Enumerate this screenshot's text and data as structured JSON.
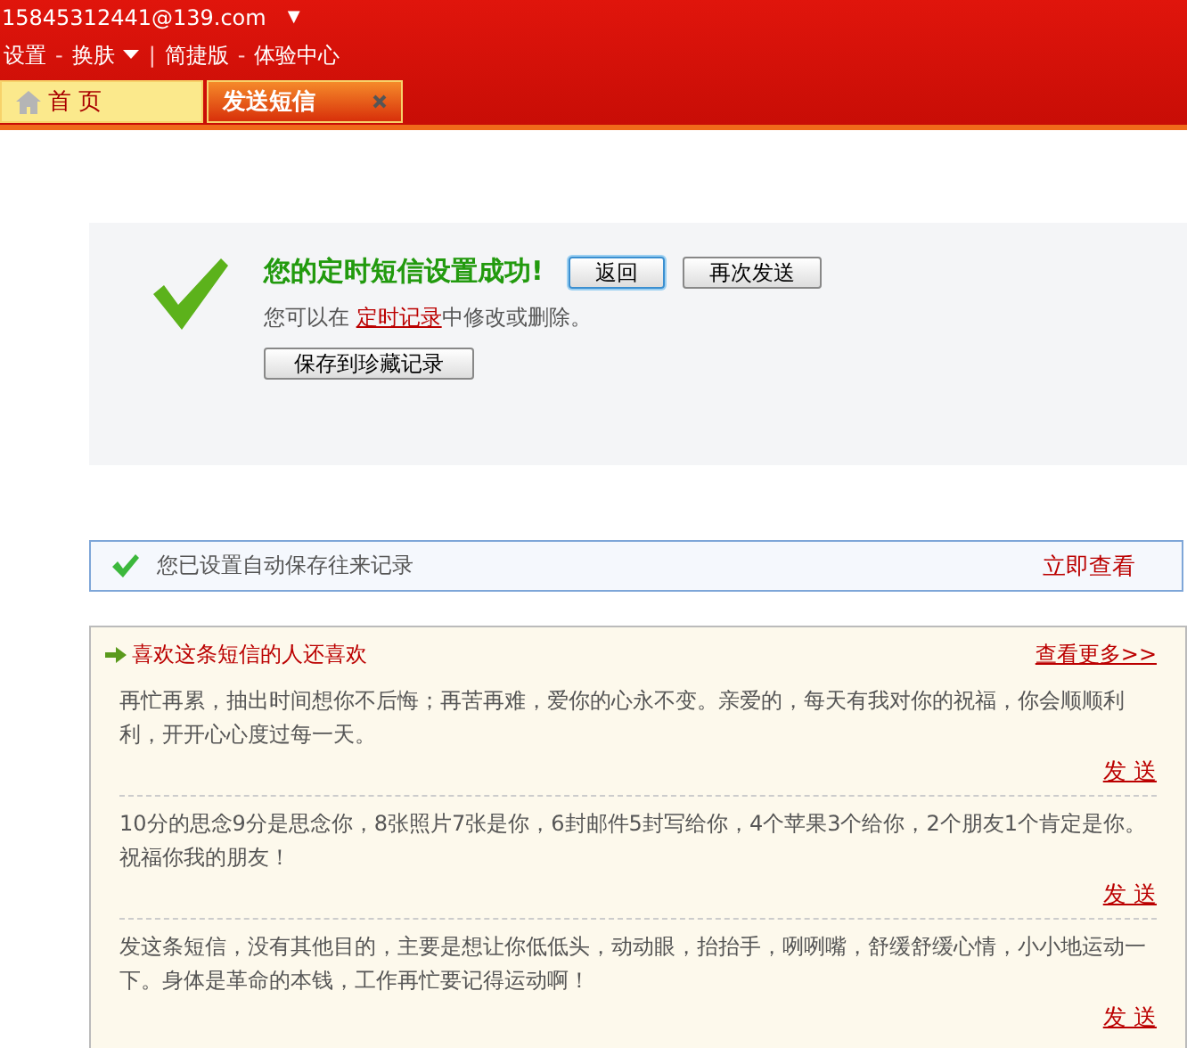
{
  "header": {
    "account": "15845312441@139.com",
    "account_menu": "▼",
    "links": [
      {
        "label": "设置"
      },
      {
        "separator": "-",
        "label": "换肤",
        "menu": true
      },
      {
        "separator": "|",
        "label": "简捷版"
      },
      {
        "separator": "-",
        "label": "体验中心"
      }
    ]
  },
  "tabs": [
    {
      "label": "首 页",
      "selected": false,
      "closable": false
    },
    {
      "label": "发送短信",
      "selected": true,
      "closable": true
    }
  ],
  "success": {
    "title": "您的定时短信设置成功!",
    "note_before": "您可以在 ",
    "note_link": "定时记录",
    "note_after": "中修改或删除。",
    "buttons": [
      {
        "label": "返回",
        "focused": true
      },
      {
        "label": "再次发送",
        "focused": false
      }
    ],
    "save_button": "保存到珍藏记录"
  },
  "notice": {
    "text": "您已设置自动保存往来记录",
    "link": "立即查看"
  },
  "recommend": {
    "title": "喜欢这条短信的人还喜欢",
    "more": "查看更多>>",
    "items": [
      {
        "text": "再忙再累，抽出时间想你不后悔；再苦再难，爱你的心永不变。亲爱的，每天有我对你的祝福，你会顺顺利利，开开心心度过每一天。",
        "action": "发 送"
      },
      {
        "text": "10分的思念9分是思念你，8张照片7张是你，6封邮件5封写给你，4个苹果3个给你，2个朋友1个肯定是你。祝福你我的朋友！",
        "action": "发 送"
      },
      {
        "text": "发这条短信，没有其他目的，主要是想让你低低头，动动眼，抬抬手，咧咧嘴，舒缓舒缓心情，小小地运动一下。身体是革命的本钱，工作再忙要记得运动啊！",
        "action": "发 送"
      }
    ]
  }
}
